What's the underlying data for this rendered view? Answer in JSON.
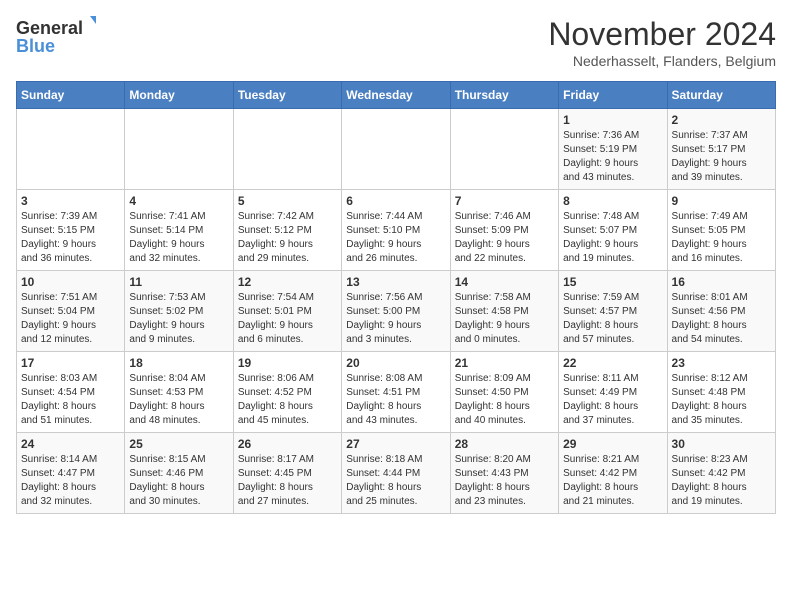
{
  "logo": {
    "line1": "General",
    "line2": "Blue"
  },
  "title": "November 2024",
  "location": "Nederhasselt, Flanders, Belgium",
  "weekdays": [
    "Sunday",
    "Monday",
    "Tuesday",
    "Wednesday",
    "Thursday",
    "Friday",
    "Saturday"
  ],
  "weeks": [
    [
      {
        "day": "",
        "info": ""
      },
      {
        "day": "",
        "info": ""
      },
      {
        "day": "",
        "info": ""
      },
      {
        "day": "",
        "info": ""
      },
      {
        "day": "",
        "info": ""
      },
      {
        "day": "1",
        "info": "Sunrise: 7:36 AM\nSunset: 5:19 PM\nDaylight: 9 hours\nand 43 minutes."
      },
      {
        "day": "2",
        "info": "Sunrise: 7:37 AM\nSunset: 5:17 PM\nDaylight: 9 hours\nand 39 minutes."
      }
    ],
    [
      {
        "day": "3",
        "info": "Sunrise: 7:39 AM\nSunset: 5:15 PM\nDaylight: 9 hours\nand 36 minutes."
      },
      {
        "day": "4",
        "info": "Sunrise: 7:41 AM\nSunset: 5:14 PM\nDaylight: 9 hours\nand 32 minutes."
      },
      {
        "day": "5",
        "info": "Sunrise: 7:42 AM\nSunset: 5:12 PM\nDaylight: 9 hours\nand 29 minutes."
      },
      {
        "day": "6",
        "info": "Sunrise: 7:44 AM\nSunset: 5:10 PM\nDaylight: 9 hours\nand 26 minutes."
      },
      {
        "day": "7",
        "info": "Sunrise: 7:46 AM\nSunset: 5:09 PM\nDaylight: 9 hours\nand 22 minutes."
      },
      {
        "day": "8",
        "info": "Sunrise: 7:48 AM\nSunset: 5:07 PM\nDaylight: 9 hours\nand 19 minutes."
      },
      {
        "day": "9",
        "info": "Sunrise: 7:49 AM\nSunset: 5:05 PM\nDaylight: 9 hours\nand 16 minutes."
      }
    ],
    [
      {
        "day": "10",
        "info": "Sunrise: 7:51 AM\nSunset: 5:04 PM\nDaylight: 9 hours\nand 12 minutes."
      },
      {
        "day": "11",
        "info": "Sunrise: 7:53 AM\nSunset: 5:02 PM\nDaylight: 9 hours\nand 9 minutes."
      },
      {
        "day": "12",
        "info": "Sunrise: 7:54 AM\nSunset: 5:01 PM\nDaylight: 9 hours\nand 6 minutes."
      },
      {
        "day": "13",
        "info": "Sunrise: 7:56 AM\nSunset: 5:00 PM\nDaylight: 9 hours\nand 3 minutes."
      },
      {
        "day": "14",
        "info": "Sunrise: 7:58 AM\nSunset: 4:58 PM\nDaylight: 9 hours\nand 0 minutes."
      },
      {
        "day": "15",
        "info": "Sunrise: 7:59 AM\nSunset: 4:57 PM\nDaylight: 8 hours\nand 57 minutes."
      },
      {
        "day": "16",
        "info": "Sunrise: 8:01 AM\nSunset: 4:56 PM\nDaylight: 8 hours\nand 54 minutes."
      }
    ],
    [
      {
        "day": "17",
        "info": "Sunrise: 8:03 AM\nSunset: 4:54 PM\nDaylight: 8 hours\nand 51 minutes."
      },
      {
        "day": "18",
        "info": "Sunrise: 8:04 AM\nSunset: 4:53 PM\nDaylight: 8 hours\nand 48 minutes."
      },
      {
        "day": "19",
        "info": "Sunrise: 8:06 AM\nSunset: 4:52 PM\nDaylight: 8 hours\nand 45 minutes."
      },
      {
        "day": "20",
        "info": "Sunrise: 8:08 AM\nSunset: 4:51 PM\nDaylight: 8 hours\nand 43 minutes."
      },
      {
        "day": "21",
        "info": "Sunrise: 8:09 AM\nSunset: 4:50 PM\nDaylight: 8 hours\nand 40 minutes."
      },
      {
        "day": "22",
        "info": "Sunrise: 8:11 AM\nSunset: 4:49 PM\nDaylight: 8 hours\nand 37 minutes."
      },
      {
        "day": "23",
        "info": "Sunrise: 8:12 AM\nSunset: 4:48 PM\nDaylight: 8 hours\nand 35 minutes."
      }
    ],
    [
      {
        "day": "24",
        "info": "Sunrise: 8:14 AM\nSunset: 4:47 PM\nDaylight: 8 hours\nand 32 minutes."
      },
      {
        "day": "25",
        "info": "Sunrise: 8:15 AM\nSunset: 4:46 PM\nDaylight: 8 hours\nand 30 minutes."
      },
      {
        "day": "26",
        "info": "Sunrise: 8:17 AM\nSunset: 4:45 PM\nDaylight: 8 hours\nand 27 minutes."
      },
      {
        "day": "27",
        "info": "Sunrise: 8:18 AM\nSunset: 4:44 PM\nDaylight: 8 hours\nand 25 minutes."
      },
      {
        "day": "28",
        "info": "Sunrise: 8:20 AM\nSunset: 4:43 PM\nDaylight: 8 hours\nand 23 minutes."
      },
      {
        "day": "29",
        "info": "Sunrise: 8:21 AM\nSunset: 4:42 PM\nDaylight: 8 hours\nand 21 minutes."
      },
      {
        "day": "30",
        "info": "Sunrise: 8:23 AM\nSunset: 4:42 PM\nDaylight: 8 hours\nand 19 minutes."
      }
    ]
  ]
}
